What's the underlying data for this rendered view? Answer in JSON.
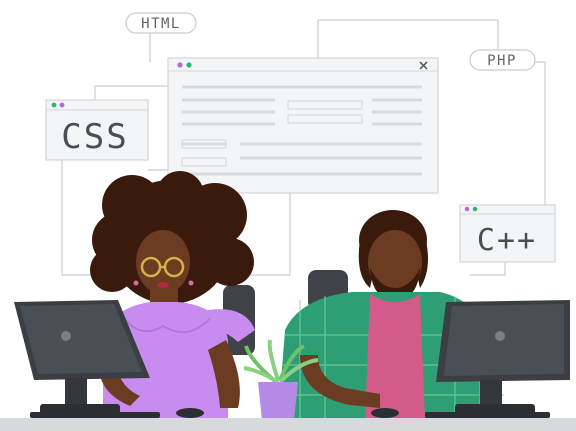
{
  "labels": {
    "html_tag": "HTML",
    "php_tag": "PHP",
    "css_window": "CSS",
    "cpp_window": "C++"
  },
  "colors": {
    "line": "#c9ccd0",
    "window_fill": "#f4f5f6",
    "window_border": "#d3d6da",
    "dot_green": "#2bb673",
    "dot_purple": "#b36ad9",
    "top_purple": "#c88cf0",
    "shirt_green": "#2e9e74",
    "skin": "#6b3b22",
    "hair": "#3a1a0c",
    "monitor": "#3b3f44",
    "plant_pot": "#b48ae6"
  }
}
